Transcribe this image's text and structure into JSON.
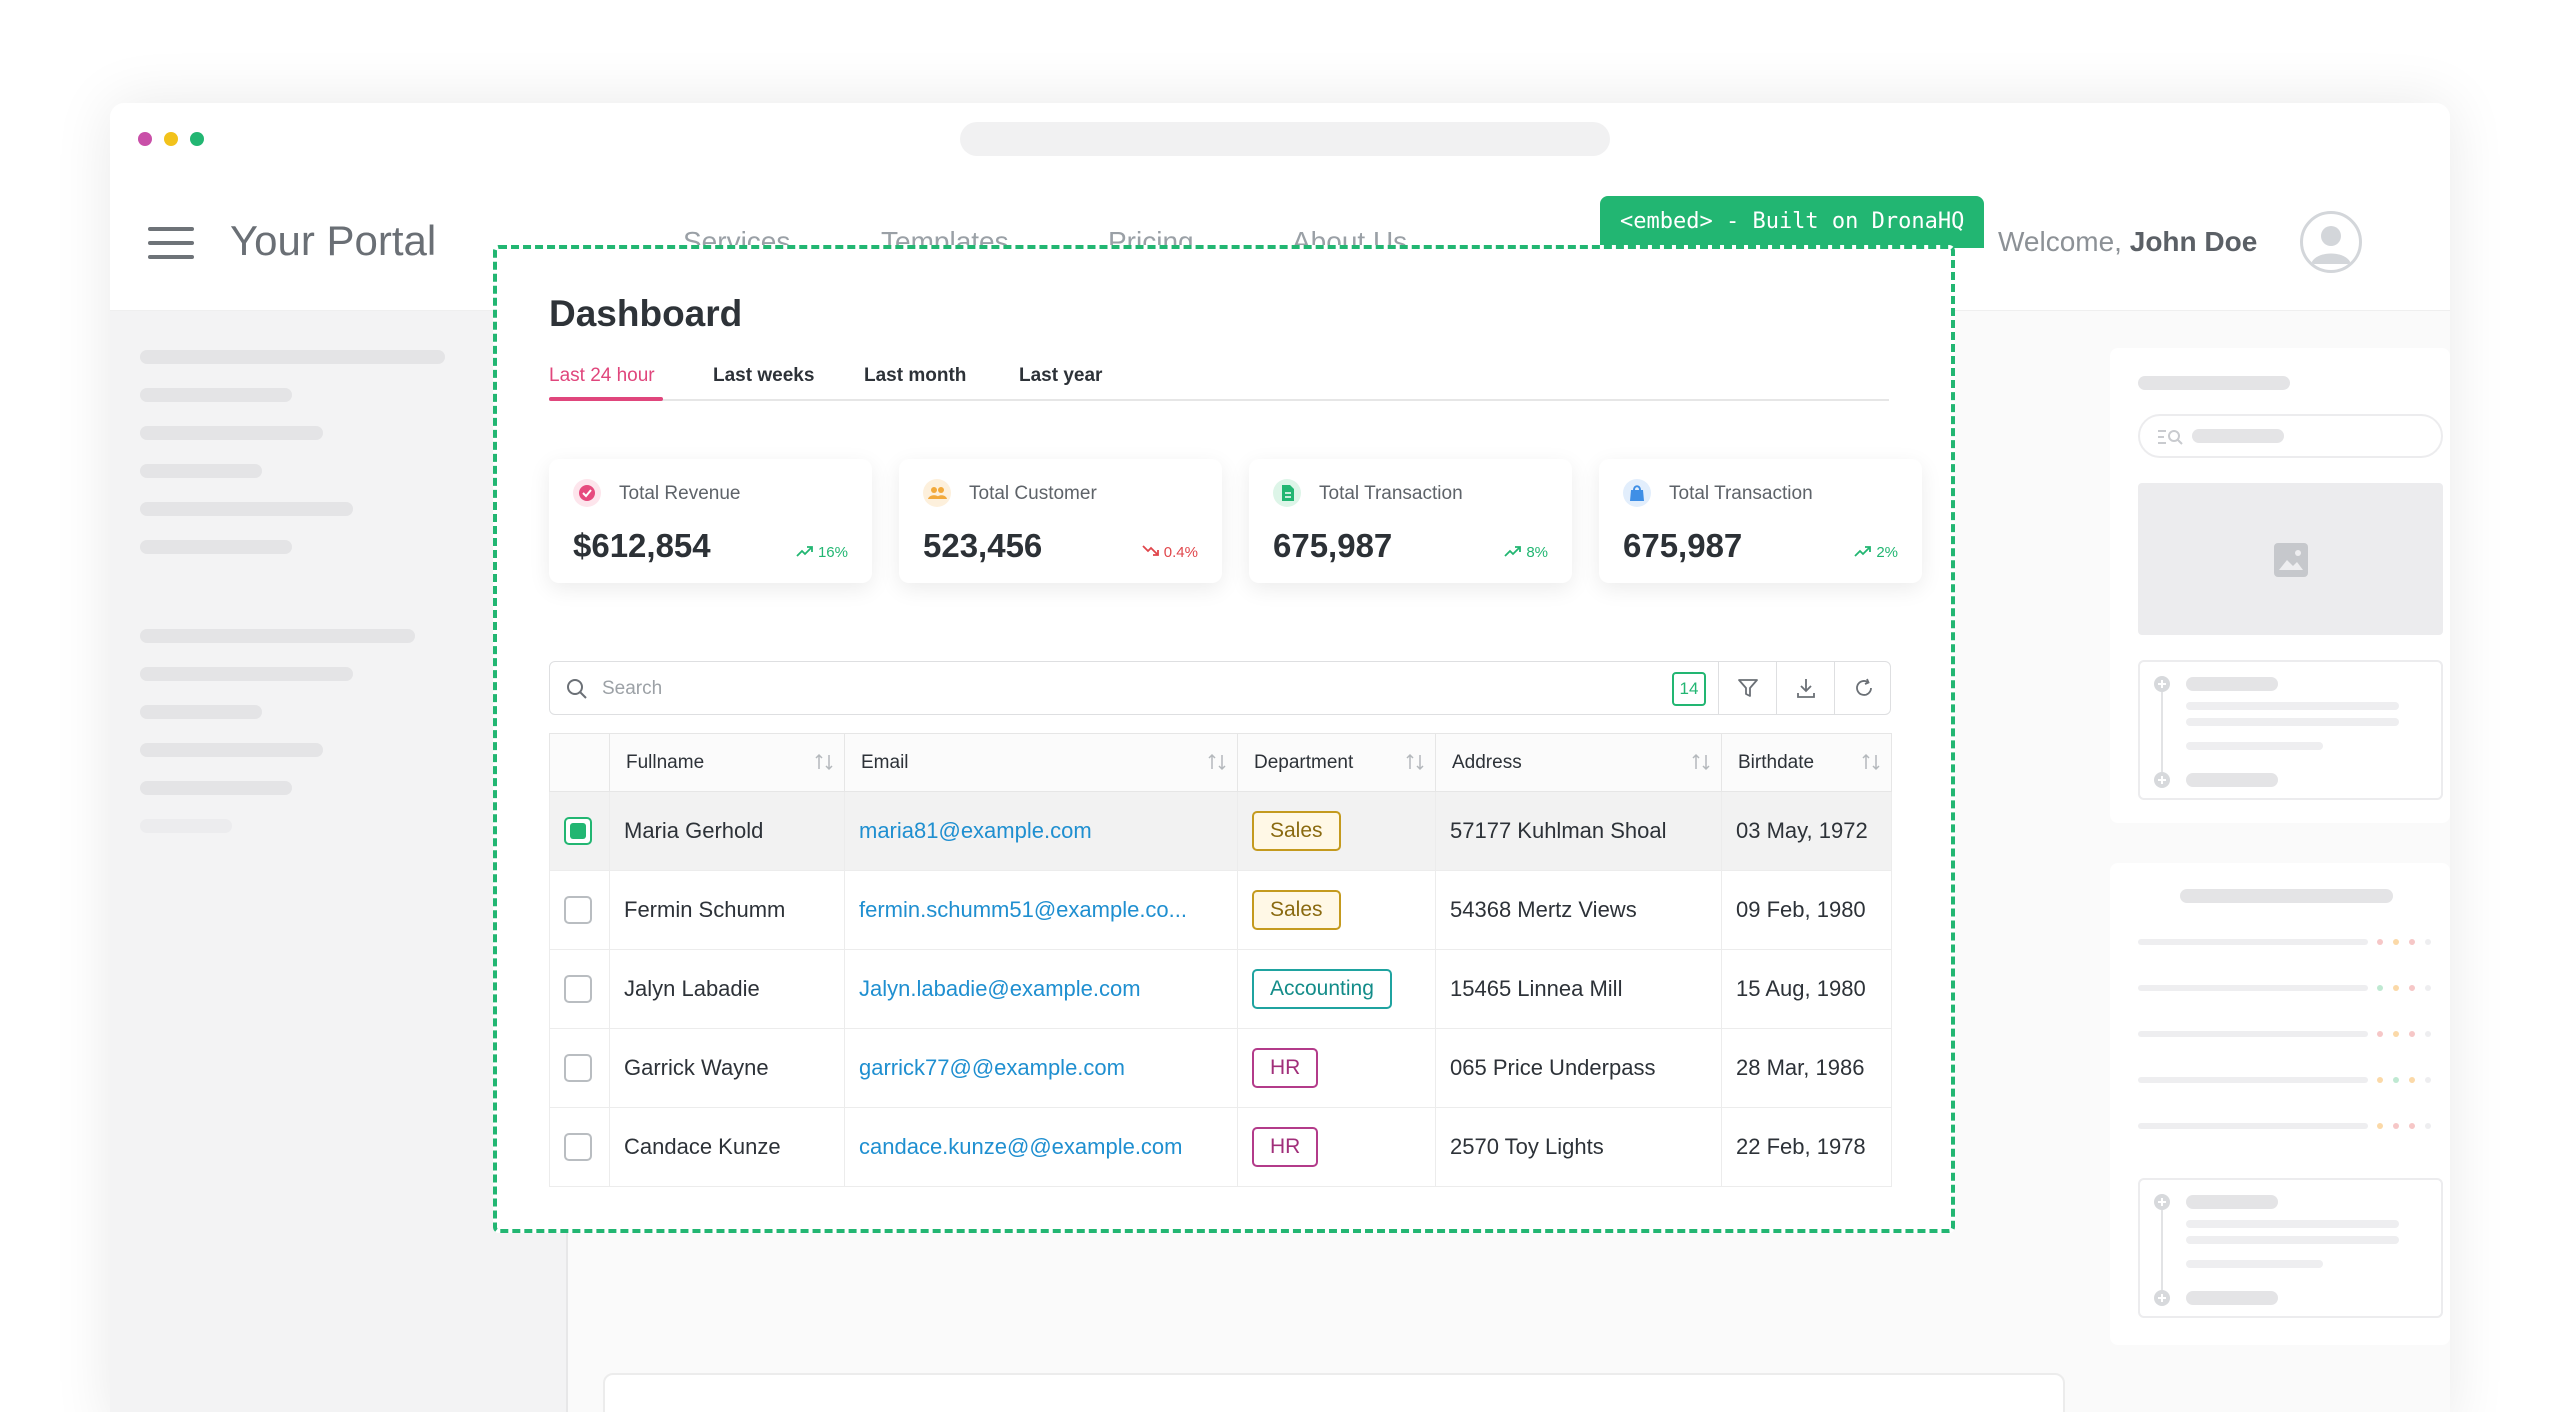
{
  "header": {
    "brand": "Your Portal",
    "nav": [
      "Services",
      "Templates",
      "Pricing",
      "About Us"
    ],
    "welcome_prefix": "Welcome,",
    "user_name": "John Doe"
  },
  "embed_tag": "<embed> - Built on DronaHQ",
  "dashboard": {
    "title": "Dashboard",
    "tabs": [
      "Last 24 hour",
      "Last weeks",
      "Last month",
      "Last year"
    ],
    "active_tab": "Last 24 hour",
    "stats": [
      {
        "label": "Total Revenue",
        "value": "$612,854",
        "trend": "16%",
        "direction": "up",
        "color": "#e64b7e",
        "icon": "badge-icon"
      },
      {
        "label": "Total Customer",
        "value": "523,456",
        "trend": "0.4%",
        "direction": "down",
        "color": "#f2a93b",
        "icon": "users-icon"
      },
      {
        "label": "Total Transaction",
        "value": "675,987",
        "trend": "8%",
        "direction": "up",
        "color": "#22b672",
        "icon": "document-icon"
      },
      {
        "label": "Total Transaction",
        "value": "675,987",
        "trend": "2%",
        "direction": "up",
        "color": "#3f8fe6",
        "icon": "bag-icon"
      }
    ],
    "search_placeholder": "Search",
    "record_count": "14",
    "columns": [
      "Fullname",
      "Email",
      "Department",
      "Address",
      "Birthdate"
    ],
    "rows": [
      {
        "name": "Maria Gerhold",
        "email": "maria81@example.com",
        "dept": "Sales",
        "address": "57177 Kuhlman Shoal",
        "birthdate": "03 May, 1972",
        "checked": true
      },
      {
        "name": "Fermin Schumm",
        "email": "fermin.schumm51@example.co...",
        "dept": "Sales",
        "address": "54368 Mertz Views",
        "birthdate": "09 Feb, 1980",
        "checked": false
      },
      {
        "name": "Jalyn Labadie",
        "email": "Jalyn.labadie@example.com",
        "dept": "Accounting",
        "address": "15465 Linnea Mill",
        "birthdate": "15 Aug, 1980",
        "checked": false
      },
      {
        "name": "Garrick Wayne",
        "email": "garrick77@@example.com",
        "dept": "HR",
        "address": "065 Price Underpass",
        "birthdate": "28 Mar, 1986",
        "checked": false
      },
      {
        "name": "Candace Kunze",
        "email": "candace.kunze@@example.com",
        "dept": "HR",
        "address": "2570 Toy Lights",
        "birthdate": "22 Feb, 1978",
        "checked": false
      }
    ]
  },
  "colors": {
    "accent_green": "#22b672",
    "tab_active": "#e0467c",
    "trend_up": "#22b672",
    "trend_down": "#e0464b",
    "dept": {
      "Sales": {
        "border": "#c49a1e",
        "text": "#8a6a10",
        "bg": "#fff8e6"
      },
      "Accounting": {
        "border": "#1fa3a0",
        "text": "#138c89",
        "bg": "#ffffff"
      },
      "HR": {
        "border": "#b33b8a",
        "text": "#a12f7a",
        "bg": "#ffffff"
      }
    }
  }
}
